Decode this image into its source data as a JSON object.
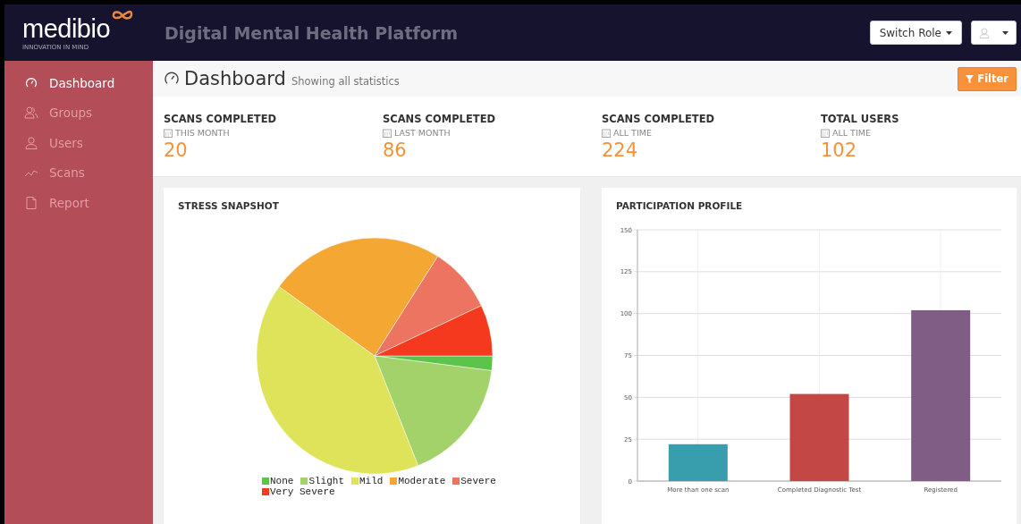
{
  "header": {
    "logo": "medibio",
    "tagline": "INNOVATION IN MIND",
    "title": "Digital Mental Health Platform",
    "switch_role": "Switch Role"
  },
  "sidebar": {
    "items": [
      {
        "label": "Dashboard",
        "selected": true
      },
      {
        "label": "Groups",
        "selected": false
      },
      {
        "label": "Users",
        "selected": false
      },
      {
        "label": "Scans",
        "selected": false
      },
      {
        "label": "Report",
        "selected": false
      }
    ]
  },
  "page_header": {
    "title": "Dashboard",
    "subtitle": "Showing all statistics",
    "filter_button": "Filter"
  },
  "stats": [
    {
      "label": "SCANS COMPLETED",
      "period": "THIS MONTH",
      "value": "20"
    },
    {
      "label": "SCANS COMPLETED",
      "period": "LAST MONTH",
      "value": "86"
    },
    {
      "label": "SCANS COMPLETED",
      "period": "ALL TIME",
      "value": "224"
    },
    {
      "label": "TOTAL USERS",
      "period": "ALL TIME",
      "value": "102"
    }
  ],
  "stress_snapshot": {
    "title": "STRESS SNAPSHOT",
    "slices": [
      {
        "color": "#5cc44a"
      },
      {
        "color": "#a3d16a"
      },
      {
        "color": "#dfe35a"
      },
      {
        "color": "#f4a833"
      },
      {
        "color": "#ee7462"
      },
      {
        "color": "#f5391f"
      }
    ],
    "chart_data": {
      "type": "pie",
      "categories": [
        "None",
        "Slight",
        "Mild",
        "Moderate",
        "Severe",
        "Very Severe"
      ],
      "values": [
        2,
        17,
        41,
        24,
        9,
        7
      ]
    }
  },
  "participation_profile": {
    "title": "PARTICIPATION PROFILE",
    "bars": [
      {
        "color": "#389eae"
      },
      {
        "color": "#c24745"
      },
      {
        "color": "#805d84"
      }
    ],
    "chart_data": {
      "type": "bar",
      "categories": [
        "More than one scan",
        "Completed Diagnostic Test",
        "Registered"
      ],
      "values": [
        22,
        52,
        102
      ],
      "grid": true,
      "ylim": [
        0,
        150
      ],
      "yticks": [
        0,
        25,
        50,
        75,
        100,
        125,
        150
      ]
    }
  }
}
